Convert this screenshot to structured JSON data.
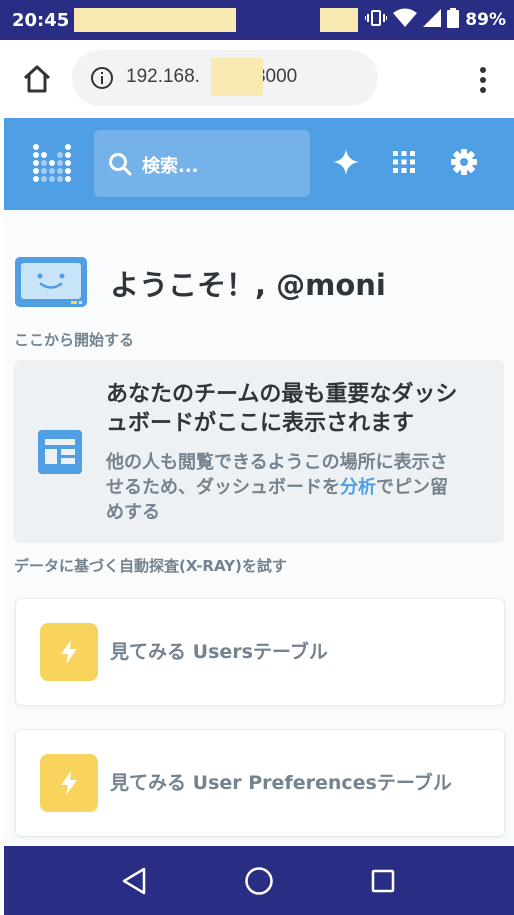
{
  "status_bar": {
    "time": "20:45",
    "battery": "89%"
  },
  "browser": {
    "url_prefix": "192.168.",
    "url_suffix": "3000"
  },
  "header": {
    "search_placeholder": "検索..."
  },
  "main": {
    "welcome": "ようこそ！, @moni",
    "start_label": "ここから開始する",
    "dashboard_card": {
      "title": "あなたのチームの最も重要なダッシュボードがここに表示されます",
      "desc_before": "他の人も閲覧できるようこの場所に表示させるため、ダッシュボードを",
      "desc_link": "分析",
      "desc_after": "でピン留めする"
    },
    "xray_label": "データに基づく自動探査(X-RAY)を試す",
    "xray_items": [
      {
        "prefix": "見てみる",
        "table": "Users",
        "suffix": "テーブル"
      },
      {
        "prefix": "見てみる",
        "table": "User Preferences",
        "suffix": "テーブル"
      }
    ]
  },
  "colors": {
    "accent": "#509ee3",
    "system_bar": "#2a2d84",
    "xray_icon": "#f9d45c"
  }
}
